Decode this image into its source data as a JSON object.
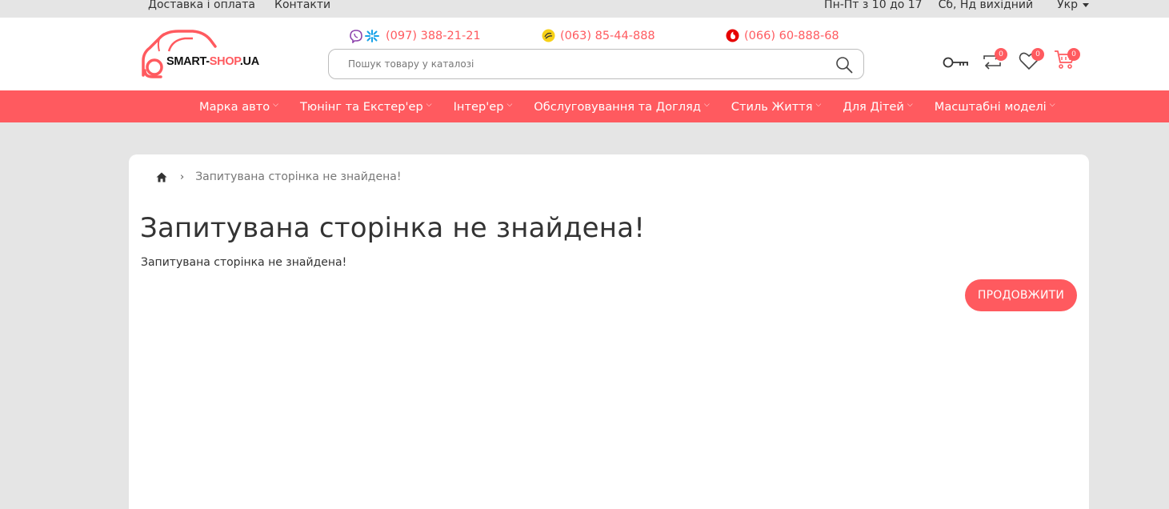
{
  "topbar": {
    "links": [
      "Доставка і оплата",
      "Контакти"
    ],
    "hours_weekdays": "Пн-Пт з 10 до 17",
    "hours_weekend": "Сб, Нд вихідний",
    "language": "Укр"
  },
  "header": {
    "logo_main": "SMART-",
    "logo_accent": "SHOP",
    "logo_suffix": ".UA",
    "phones": [
      {
        "operator": "kyivstar",
        "number": "(097) 388-21-21"
      },
      {
        "operator": "lifecell",
        "number": "(063) 85-44-888"
      },
      {
        "operator": "vodafone",
        "number": "(066) 60-888-68"
      }
    ],
    "search_placeholder": "Пошук товару у каталозі",
    "compare_count": "0",
    "wishlist_count": "0",
    "cart_count": "0"
  },
  "nav": {
    "items": [
      "Марка авто",
      "Тюнінг та Екстер'ер",
      "Інтер'ер",
      "Обслуговування та Догляд",
      "Стиль Життя",
      "Для Дітей",
      "Масштабні моделі"
    ]
  },
  "content": {
    "breadcrumb_current": "Запитувана сторінка не знайдена!",
    "title": "Запитувана сторінка не знайдена!",
    "text": "Запитувана сторінка не знайдена!",
    "continue_label": "ПРОДОВЖИТИ"
  },
  "colors": {
    "accent": "#ff5a5f",
    "background": "#e5e5e5"
  }
}
